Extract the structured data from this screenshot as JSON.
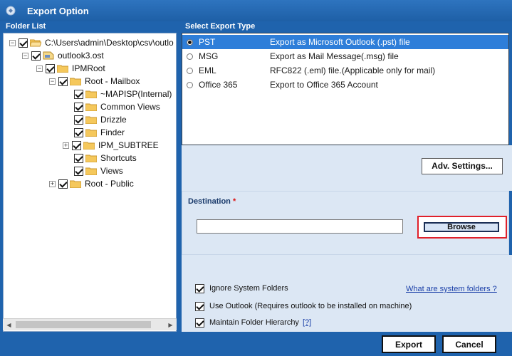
{
  "window": {
    "title": "Export Option"
  },
  "folder_list": {
    "label": "Folder List",
    "items": [
      {
        "label": "C:\\Users\\admin\\Desktop\\csv\\outlo",
        "checked": true,
        "icon": "open-folder-icon"
      },
      {
        "label": "outlook3.ost",
        "checked": true,
        "icon": "ost-file-icon"
      },
      {
        "label": "IPMRoot",
        "checked": true,
        "icon": "folder-icon"
      },
      {
        "label": "Root - Mailbox",
        "checked": true,
        "icon": "folder-icon"
      },
      {
        "label": "~MAPISP(Internal)",
        "checked": true,
        "icon": "folder-icon"
      },
      {
        "label": "Common Views",
        "checked": true,
        "icon": "folder-icon"
      },
      {
        "label": "Drizzle",
        "checked": true,
        "icon": "folder-icon"
      },
      {
        "label": "Finder",
        "checked": true,
        "icon": "folder-icon"
      },
      {
        "label": "IPM_SUBTREE",
        "checked": true,
        "icon": "folder-icon"
      },
      {
        "label": "Shortcuts",
        "checked": true,
        "icon": "folder-icon"
      },
      {
        "label": "Views",
        "checked": true,
        "icon": "folder-icon"
      },
      {
        "label": "Root - Public",
        "checked": true,
        "icon": "folder-icon"
      }
    ]
  },
  "export_type": {
    "label": "Select Export Type",
    "selected": "PST",
    "options": [
      {
        "name": "PST",
        "description": "Export as Microsoft Outlook (.pst) file"
      },
      {
        "name": "MSG",
        "description": "Export as Mail Message(.msg) file"
      },
      {
        "name": "EML",
        "description": "RFC822 (.eml) file.(Applicable only for mail)"
      },
      {
        "name": "Office 365",
        "description": "Export to Office 365 Account"
      }
    ]
  },
  "adv_settings_label": "Adv. Settings...",
  "destination": {
    "label": "Destination",
    "required_mark": "*",
    "value": "",
    "browse_label": "Browse"
  },
  "options": {
    "ignore_system_folders": {
      "label": "Ignore System Folders",
      "checked": true
    },
    "system_folders_link": "What are system folders ?",
    "use_outlook": {
      "label": "Use Outlook (Requires outlook to be installed on machine)",
      "checked": true
    },
    "maintain_hierarchy": {
      "label": "Maintain Folder Hierarchy",
      "checked": true
    },
    "hierarchy_help_link": "[?]"
  },
  "footer": {
    "export_label": "Export",
    "cancel_label": "Cancel"
  },
  "colors": {
    "title_blue": "#1f63ad",
    "selection_blue": "#2e7ed9",
    "highlight_red": "#e0202a",
    "panel_bg": "#dce7f4"
  }
}
